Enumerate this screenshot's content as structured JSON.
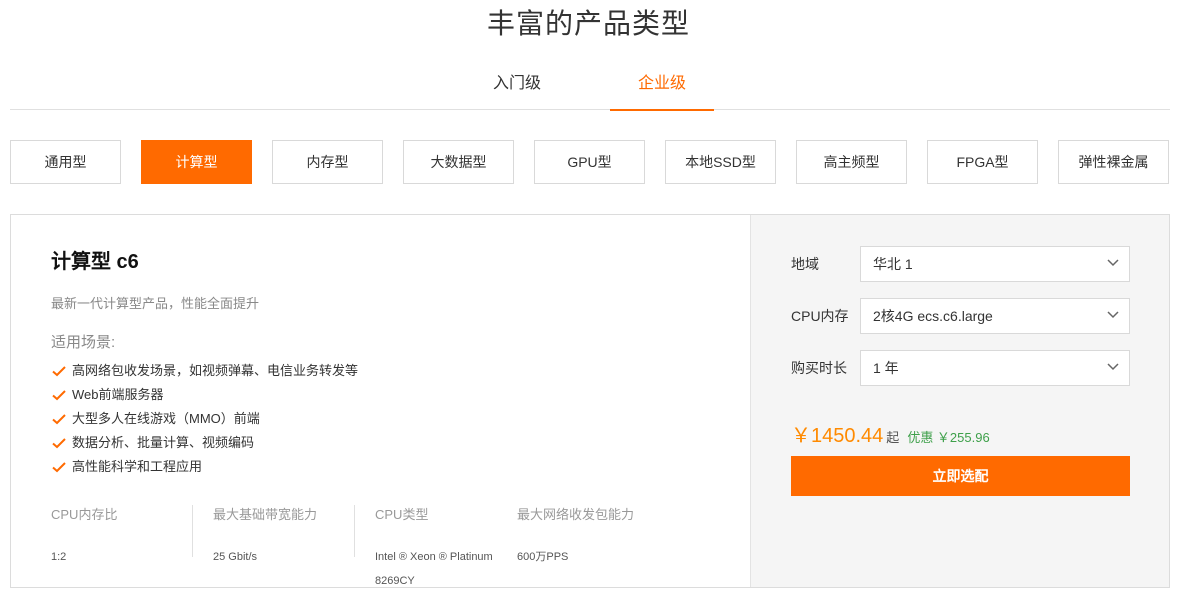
{
  "page_title": "丰富的产品类型",
  "level_tabs": [
    {
      "label": "入门级",
      "active": false
    },
    {
      "label": "企业级",
      "active": true
    }
  ],
  "type_tabs": [
    {
      "label": "通用型",
      "active": false
    },
    {
      "label": "计算型",
      "active": true
    },
    {
      "label": "内存型",
      "active": false
    },
    {
      "label": "大数据型",
      "active": false
    },
    {
      "label": "GPU型",
      "active": false
    },
    {
      "label": "本地SSD型",
      "active": false
    },
    {
      "label": "高主频型",
      "active": false
    },
    {
      "label": "FPGA型",
      "active": false
    },
    {
      "label": "弹性裸金属",
      "active": false
    }
  ],
  "product": {
    "name": "计算型 c6",
    "description": "最新一代计算型产品，性能全面提升",
    "scenario_title": "适用场景:",
    "scenarios": [
      "高网络包收发场景，如视频弹幕、电信业务转发等",
      "Web前端服务器",
      "大型多人在线游戏（MMO）前端",
      "数据分析、批量计算、视频编码",
      "高性能科学和工程应用"
    ],
    "specs": [
      {
        "label": "CPU内存比",
        "value": "1:2"
      },
      {
        "label": "最大基础带宽能力",
        "value": "25 Gbit/s"
      },
      {
        "label": "CPU类型",
        "value": "Intel ® Xeon ® Platinum 8269CY"
      },
      {
        "label": "最大网络收发包能力",
        "value": "600万PPS"
      }
    ]
  },
  "config": {
    "region": {
      "label": "地域",
      "value": "华北 1"
    },
    "cpu_mem": {
      "label": "CPU内存",
      "value": "2核4G ecs.c6.large"
    },
    "duration": {
      "label": "购买时长",
      "value": "1 年"
    },
    "price": "￥1450.44",
    "price_unit": "起",
    "discount": "优惠 ￥255.96",
    "buy_label": "立即选配"
  },
  "colors": {
    "accent": "#ff6a00",
    "price": "#ff8a00",
    "discount": "#3ea04a"
  },
  "icons": {
    "scenario_bullet": "check-icon",
    "select_arrow": "chevron-down-icon"
  }
}
